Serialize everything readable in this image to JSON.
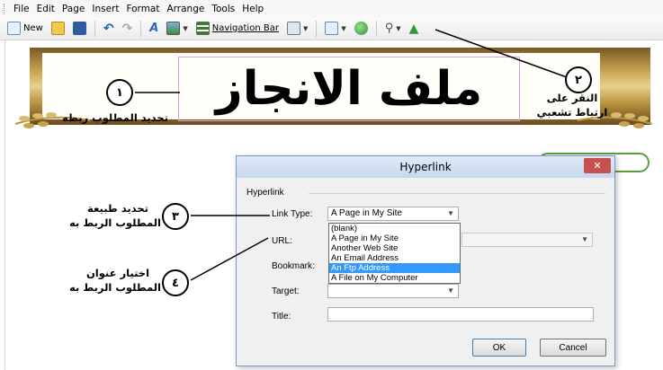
{
  "menu": [
    "File",
    "Edit",
    "Page",
    "Insert",
    "Format",
    "Arrange",
    "Tools",
    "Help"
  ],
  "toolbar": {
    "new_label": "New",
    "navbar_label": "Navigation Bar"
  },
  "banner": {
    "title": "ملف الانجاز"
  },
  "annotations": {
    "a1_number": "١",
    "a1_text": "تحديد المطلوب ربطه",
    "a2_number": "٢",
    "a2_line1": "النقر على",
    "a2_line2": "ارتباط تشعبي",
    "a3_number": "٣",
    "a3_line1": "تحديد طبيعة",
    "a3_line2": "المطلوب الربط به",
    "a4_number": "٤",
    "a4_line1": "اختيار عنوان",
    "a4_line2": "المطلوب الربط به"
  },
  "dialog": {
    "title": "Hyperlink",
    "close": "✕",
    "group": "Hyperlink",
    "link_type_label": "Link Type:",
    "link_type_value": "A Page in My Site",
    "url_label": "URL:",
    "bookmark_label": "Bookmark:",
    "target_label": "Target:",
    "title_label": "Title:",
    "options": [
      "(blank)",
      "A Page in My Site",
      "Another Web Site",
      "An Email Address",
      "An Ftp Address",
      "A File on My Computer"
    ],
    "selected_option": "An Ftp Address",
    "ok": "OK",
    "cancel": "Cancel"
  },
  "colors": {
    "selection": "#3399ff",
    "close_button": "#c75050",
    "frame_gold": "#c9a24f"
  }
}
